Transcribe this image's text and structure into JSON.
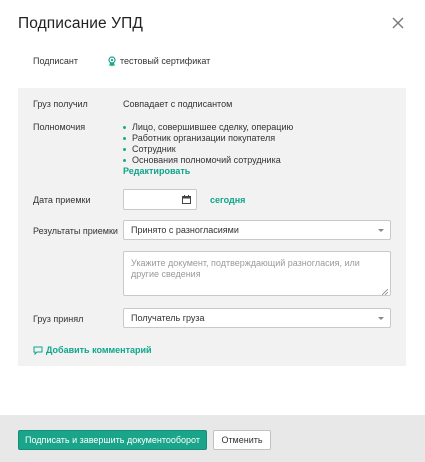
{
  "dialog": {
    "title": "Подписание УПД"
  },
  "signer": {
    "label": "Подписант",
    "value": "тестовый сертификат",
    "icon": "certificate-icon"
  },
  "cargo_received": {
    "label": "Груз получил",
    "value": "Совпадает с подписантом"
  },
  "authority": {
    "label": "Полномочия",
    "items": [
      "Лицо, совершившее сделку, операцию",
      "Работник организации покупателя",
      "Сотрудник",
      "Основания полномочий сотрудника"
    ],
    "edit_link": "Редактировать"
  },
  "receipt_date": {
    "label": "Дата приемки",
    "value": "",
    "today_link": "сегодня",
    "icon": "calendar-icon"
  },
  "receipt_results": {
    "label": "Результаты приемки",
    "selected": "Принято с разногласиями",
    "comment_placeholder": "Укажите документ, подтверждающий разногласия, или другие сведения"
  },
  "cargo_accepted": {
    "label": "Груз принял",
    "selected": "Получатель груза"
  },
  "add_comment": {
    "label": "Добавить комментарий",
    "icon": "comment-icon"
  },
  "footer": {
    "primary_button": "Подписать и завершить документооборот",
    "cancel_button": "Отменить"
  },
  "colors": {
    "accent": "#1aa58a",
    "link": "#0ea58a",
    "panel_bg": "#f2f2f2",
    "footer_bg": "#e8e8e8"
  }
}
